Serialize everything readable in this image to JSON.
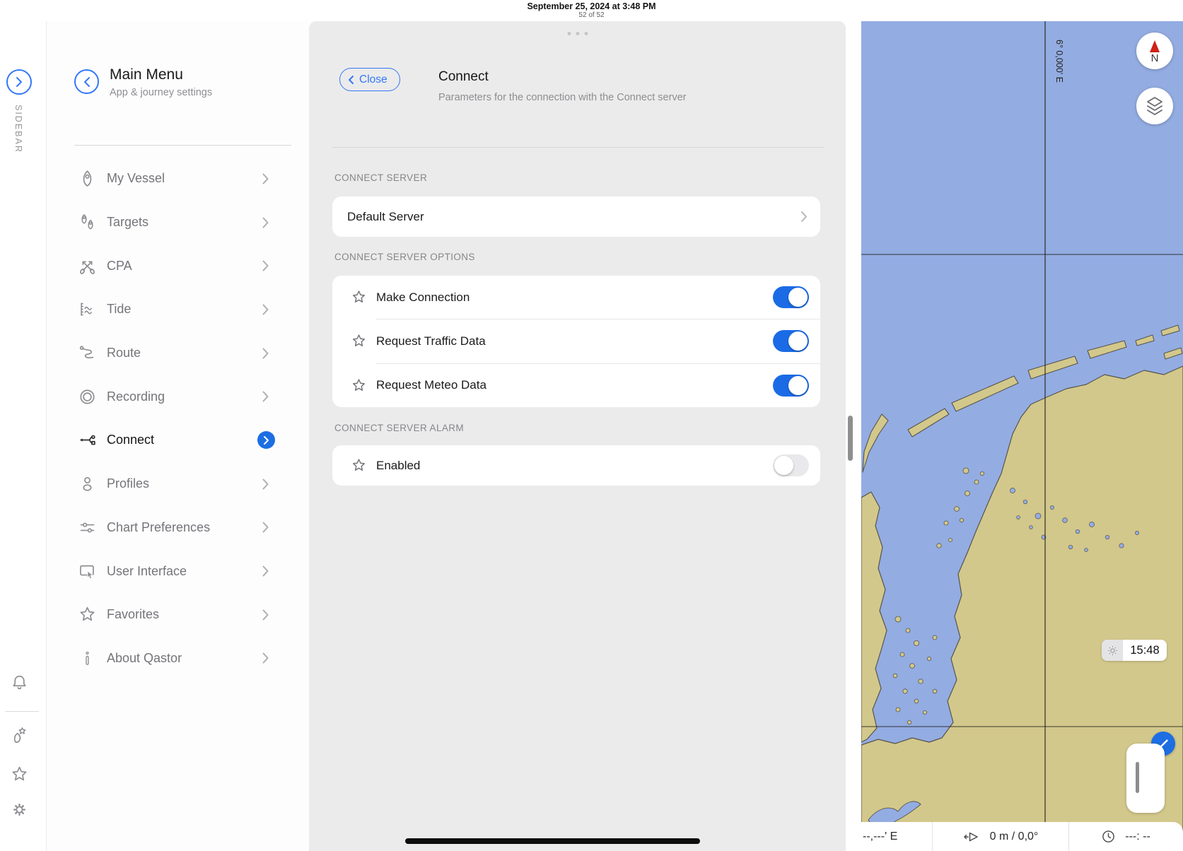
{
  "header": {
    "date_line": "September 25, 2024 at 3:48 PM",
    "page_indicator": "52 of 52"
  },
  "sidebar_rail": {
    "label": "SIDEBAR"
  },
  "main_menu": {
    "title": "Main Menu",
    "subtitle": "App & journey settings",
    "items": [
      {
        "label": "My Vessel",
        "icon": "vessel-icon"
      },
      {
        "label": "Targets",
        "icon": "targets-icon"
      },
      {
        "label": "CPA",
        "icon": "cpa-icon"
      },
      {
        "label": "Tide",
        "icon": "tide-icon"
      },
      {
        "label": "Route",
        "icon": "route-icon"
      },
      {
        "label": "Recording",
        "icon": "recording-icon"
      },
      {
        "label": "Connect",
        "icon": "connect-icon",
        "active": true
      },
      {
        "label": "Profiles",
        "icon": "profiles-icon"
      },
      {
        "label": "Chart Preferences",
        "icon": "chart-preferences-icon"
      },
      {
        "label": "User Interface",
        "icon": "user-interface-icon"
      },
      {
        "label": "Favorites",
        "icon": "star-icon"
      },
      {
        "label": "About Qastor",
        "icon": "info-icon"
      }
    ]
  },
  "connect_panel": {
    "close_label": "Close",
    "title": "Connect",
    "subtitle": "Parameters for the connection with the Connect server",
    "server_section": {
      "header": "CONNECT SERVER",
      "row_label": "Default Server"
    },
    "options_section": {
      "header": "CONNECT SERVER OPTIONS",
      "rows": [
        {
          "label": "Make Connection",
          "enabled": true
        },
        {
          "label": "Request Traffic Data",
          "enabled": true
        },
        {
          "label": "Request Meteo Data",
          "enabled": true
        }
      ]
    },
    "alarm_section": {
      "header": "CONNECT SERVER ALARM",
      "rows": [
        {
          "label": "Enabled",
          "enabled": false
        }
      ]
    }
  },
  "map": {
    "meridian_label": "6° 0,000' E",
    "compass_label": "N",
    "clock_chip": "15:48",
    "status_bar": {
      "coordinate": "--,---' E",
      "speed_heading": "0 m / 0,0°",
      "time_placeholder": "---: --"
    },
    "colors": {
      "sea": "#93ace2",
      "land": "#d3c88b",
      "accent_blue": "#1d6ee3",
      "toggle_on": "#1b6be6",
      "close_blue": "#3478f6",
      "compass_red": "#cf2118"
    }
  }
}
